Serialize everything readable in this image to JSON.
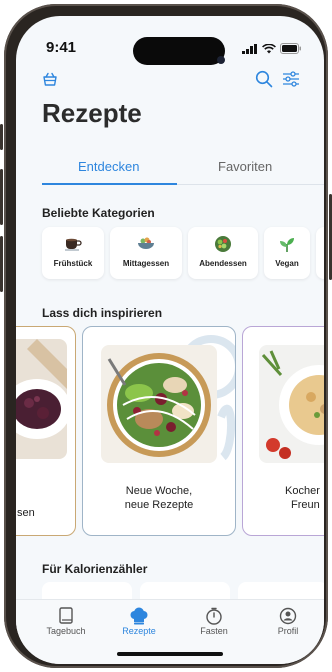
{
  "status": {
    "time": "9:41"
  },
  "header": {
    "title": "Rezepte"
  },
  "tabs": [
    {
      "label": "Entdecken",
      "active": true
    },
    {
      "label": "Favoriten",
      "active": false
    }
  ],
  "categories": {
    "title": "Beliebte Kategorien",
    "items": [
      {
        "label": "Frühstück",
        "icon": "coffee-icon"
      },
      {
        "label": "Mittagessen",
        "icon": "bowl-icon"
      },
      {
        "label": "Abendessen",
        "icon": "salad-icon"
      },
      {
        "label": "Vegan",
        "icon": "sprout-icon"
      }
    ]
  },
  "inspiration": {
    "title": "Lass dich inspirieren",
    "cards": [
      {
        "text1": "sen",
        "text2": ""
      },
      {
        "text1": "Neue Woche,",
        "text2": "neue Rezepte"
      },
      {
        "text1": "Kocher",
        "text2": "Freun"
      }
    ]
  },
  "calories": {
    "title": "Für Kalorienzähler"
  },
  "tabbar": {
    "items": [
      {
        "label": "Tagebuch",
        "icon": "book-icon",
        "active": false
      },
      {
        "label": "Rezepte",
        "icon": "chef-hat-icon",
        "active": true
      },
      {
        "label": "Fasten",
        "icon": "timer-icon",
        "active": false
      },
      {
        "label": "Profil",
        "icon": "profile-icon",
        "active": false
      }
    ]
  },
  "colors": {
    "accent": "#2e86de",
    "background": "#f5f8fb",
    "text": "#2c2c2c"
  }
}
